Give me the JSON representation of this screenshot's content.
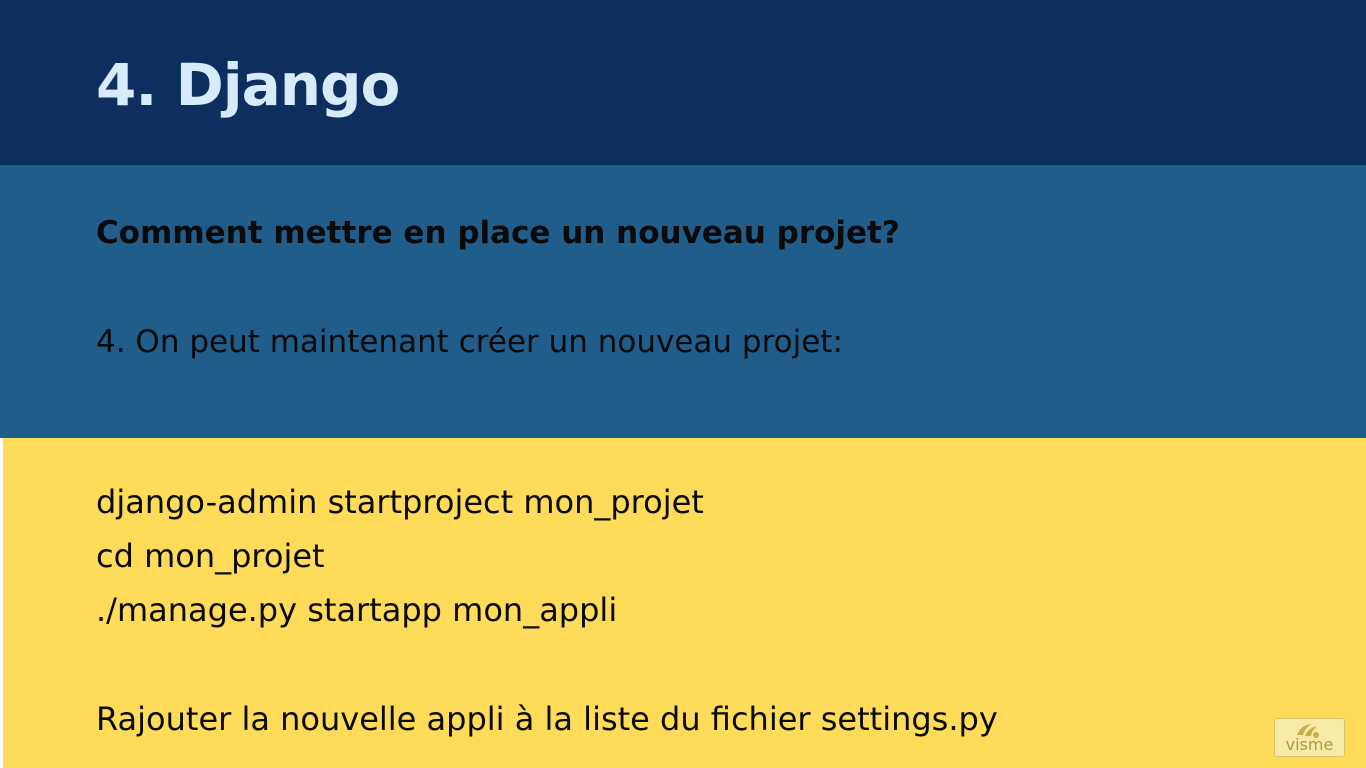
{
  "slide": {
    "title": "4. Django",
    "question": "Comment mettre en place un nouveau projet?",
    "step": "4. On peut maintenant créer un nouveau projet:",
    "commands": [
      "django-admin startproject mon_projet",
      "cd mon_projet",
      "./manage.py startapp mon_appli"
    ],
    "note": "Rajouter la nouvelle appli à la liste du fichier settings.py"
  },
  "badge": {
    "label": "visme",
    "icon": "visme-logo-icon"
  },
  "colors": {
    "header": "#0d2f60",
    "title": "#d6ecfb",
    "intro": "#215d8b",
    "code_area": "#fedc59",
    "text": "#0a0a0a"
  }
}
